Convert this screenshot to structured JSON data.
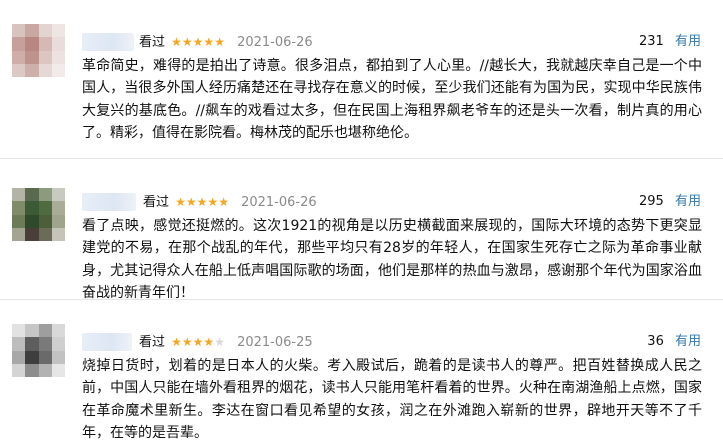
{
  "reviews": [
    {
      "status": "看过",
      "rating": 5,
      "date": "2021-06-26",
      "votes": "231",
      "useful_label": "有用",
      "text": "革命简史，难得的是拍出了诗意。很多泪点，都拍到了人心里。//越长大，我就越庆幸自己是一个中国人，当很多外国人经历痛楚还在寻找存在意义的时候，至少我们还能有为国为民，实现中华民族伟大复兴的基底色。//飙车的戏看过太多，但在民国上海租界飙老爷车的还是头一次看，制片真的用心了。精彩，值得在影院看。梅林茂的配乐也堪称绝伦。"
    },
    {
      "status": "看过",
      "rating": 5,
      "date": "2021-06-26",
      "votes": "295",
      "useful_label": "有用",
      "text": "看了点映，感觉还挺燃的。这次1921的视角是以历史横截面来展现的，国际大环境的态势下更突显建党的不易，在那个战乱的年代，那些平均只有28岁的年轻人，在国家生死存亡之际为革命事业献身，尤其记得众人在船上低声唱国际歌的场面，他们是那样的热血与激昂，感谢那个年代为国家浴血奋战的新青年们！"
    },
    {
      "status": "看过",
      "rating": 4,
      "date": "2021-06-25",
      "votes": "36",
      "useful_label": "有用",
      "text": "烧掉日货时，划着的是日本人的火柴。考入殿试后，跪着的是读书人的尊严。把百姓替换成人民之前，中国人只能在墙外看租界的烟花，读书人只能用笔杆看着的世界。火种在南湖渔船上点燃，国家在革命魔术里新生。李达在窗口看见希望的女孩，润之在外滩跑入崭新的世界，辟地开天等不了千年，在等的是吾辈。"
    }
  ]
}
